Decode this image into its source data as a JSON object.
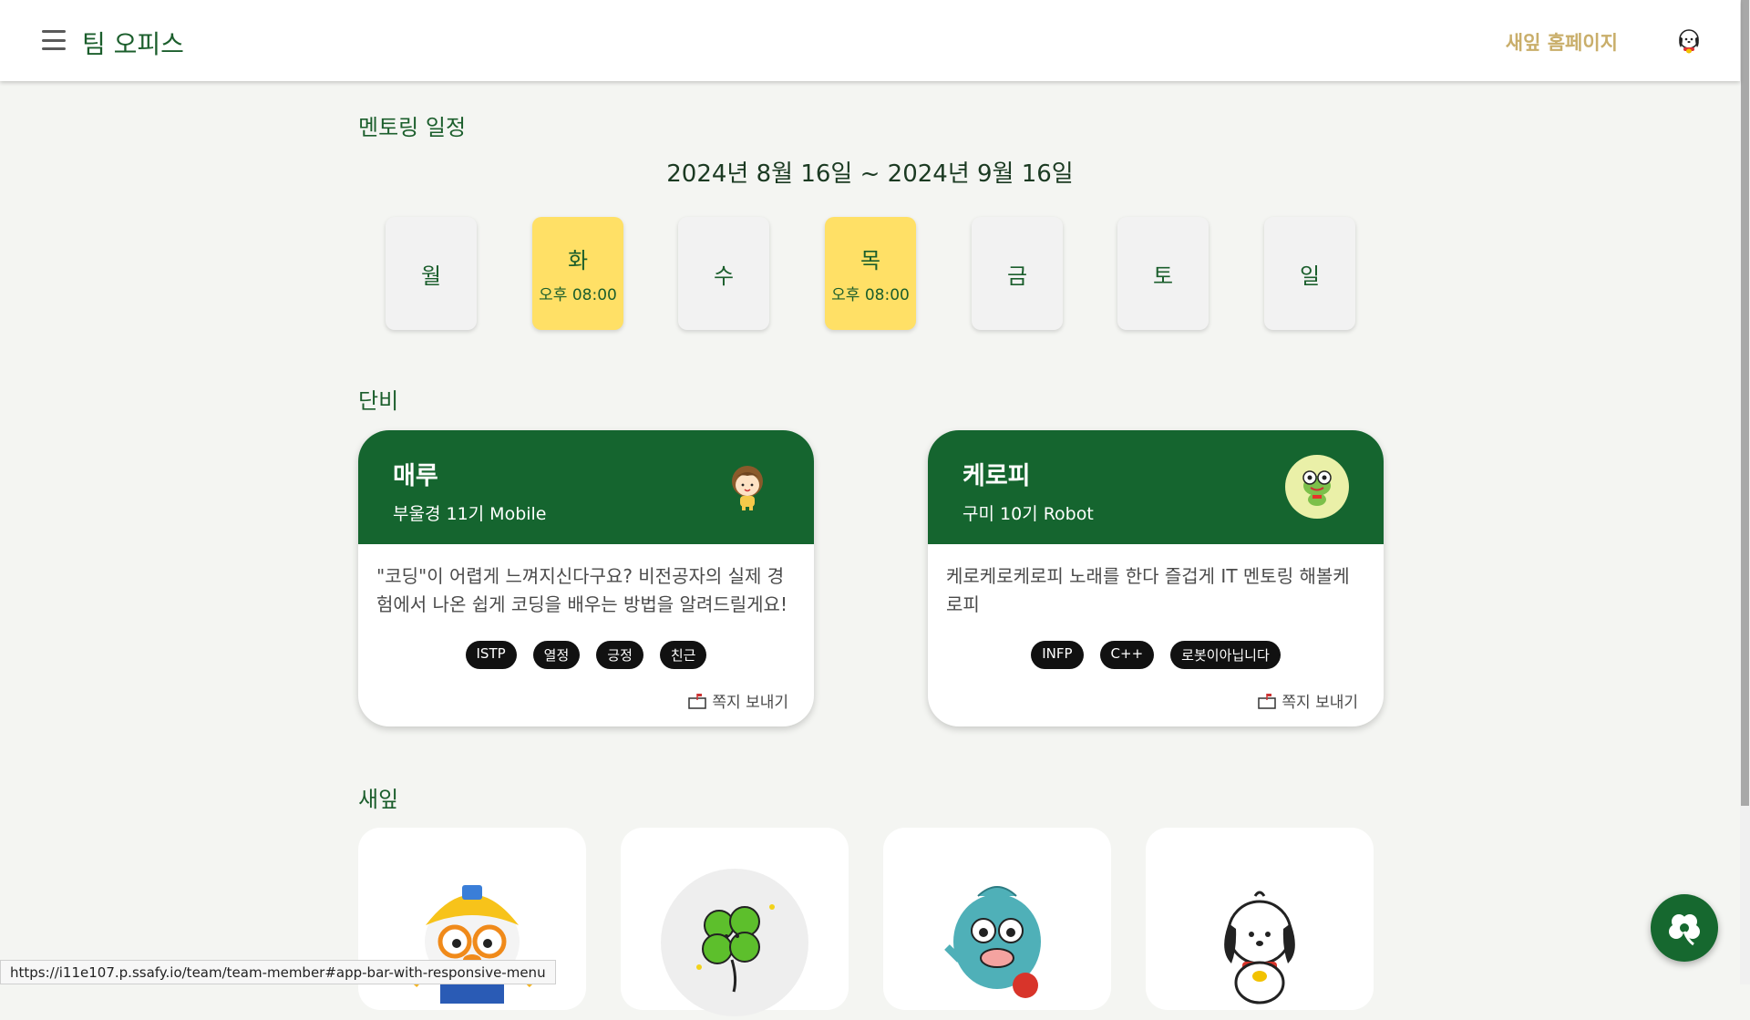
{
  "appbar": {
    "title": "팀 오피스",
    "home_link": "새잎 홈페이지"
  },
  "schedule": {
    "section_title": "멘토링 일정",
    "date_range": "2024년 8월 16일 ~ 2024년 9월 16일",
    "days": [
      {
        "label": "월",
        "time": "",
        "active": false
      },
      {
        "label": "화",
        "time": "오후 08:00",
        "active": true
      },
      {
        "label": "수",
        "time": "",
        "active": false
      },
      {
        "label": "목",
        "time": "오후 08:00",
        "active": true
      },
      {
        "label": "금",
        "time": "",
        "active": false
      },
      {
        "label": "토",
        "time": "",
        "active": false
      },
      {
        "label": "일",
        "time": "",
        "active": false
      }
    ]
  },
  "mentors": {
    "section_title": "단비",
    "cards": [
      {
        "name": "매루",
        "info": "부울경 11기 Mobile",
        "desc": "\"코딩\"이 어렵게 느껴지신다구요? 비전공자의 실제 경험에서 나온 쉽게 코딩을 배우는 방법을 알려드릴게요!",
        "tags": [
          "ISTP",
          "열정",
          "긍정",
          "친근"
        ],
        "send": "쪽지 보내기"
      },
      {
        "name": "케로피",
        "info": "구미 10기 Robot",
        "desc": "케로케로케로피 노래를 한다 즐겁게 IT 멘토링 해볼케로피",
        "tags": [
          "INFP",
          "C++",
          "로봇이아닙니다"
        ],
        "send": "쪽지 보내기"
      }
    ]
  },
  "members": {
    "section_title": "새잎",
    "avatars": [
      "penguin-avatar",
      "clover-avatar",
      "fish-avatar",
      "dog-avatar"
    ]
  },
  "status_url": "https://i11e107.p.ssafy.io/team/team-member#app-bar-with-responsive-menu",
  "colors": {
    "primary": "#15652f",
    "accent": "#ffe066",
    "gold": "#c9ae6a",
    "background": "#f4f5f2"
  }
}
